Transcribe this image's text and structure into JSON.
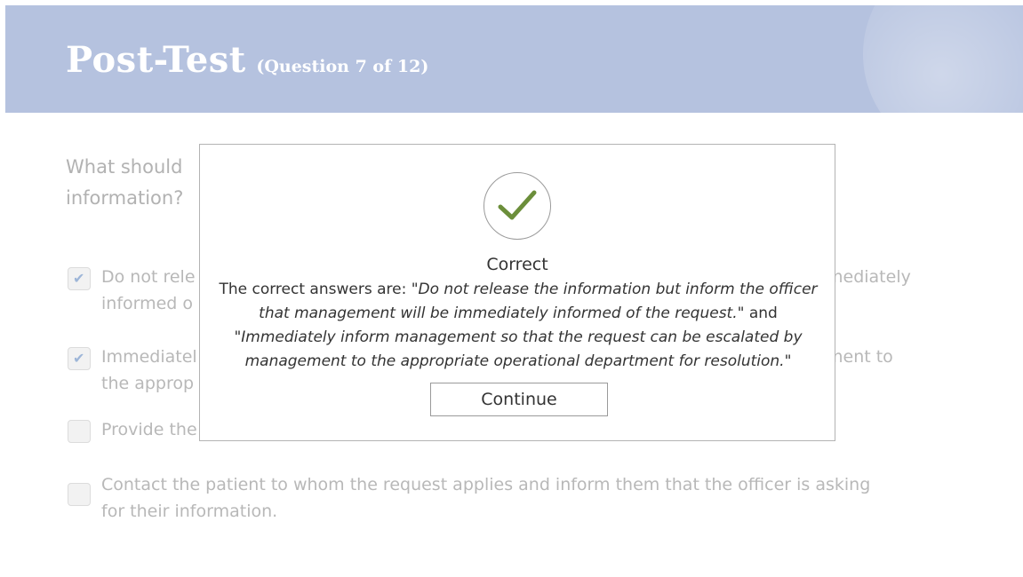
{
  "header": {
    "title": "Post-Test",
    "subtitle": "(Question 7 of 12)"
  },
  "question": {
    "line1": "What should",
    "line2": "information?"
  },
  "options": [
    {
      "checked": true,
      "line1": "Do not rele",
      "line1_tail": "mediately",
      "line2": "informed o"
    },
    {
      "checked": true,
      "line1": "Immediatel",
      "line1_tail": "ment to",
      "line2": "the approp"
    },
    {
      "checked": false,
      "line1": "Provide the"
    },
    {
      "checked": false,
      "line1": "Contact the patient to whom the request applies and inform them that the officer is asking",
      "line2": "for their information."
    }
  ],
  "modal": {
    "status_icon": "check-icon",
    "status_color": "#6b8e3a",
    "result_label": "Correct",
    "intro": "The correct answers are: ",
    "answer1": "\"Do not release the information but inform the officer that management will be immediately informed of the request.\"",
    "joiner": " and ",
    "answer2": "\"Immediately inform management so that the request can be escalated by management to the appropriate operational department for resolution.\"",
    "continue_label": "Continue"
  },
  "colors": {
    "header_bg": "#b5c2df",
    "check_color": "#6b8e3a"
  }
}
